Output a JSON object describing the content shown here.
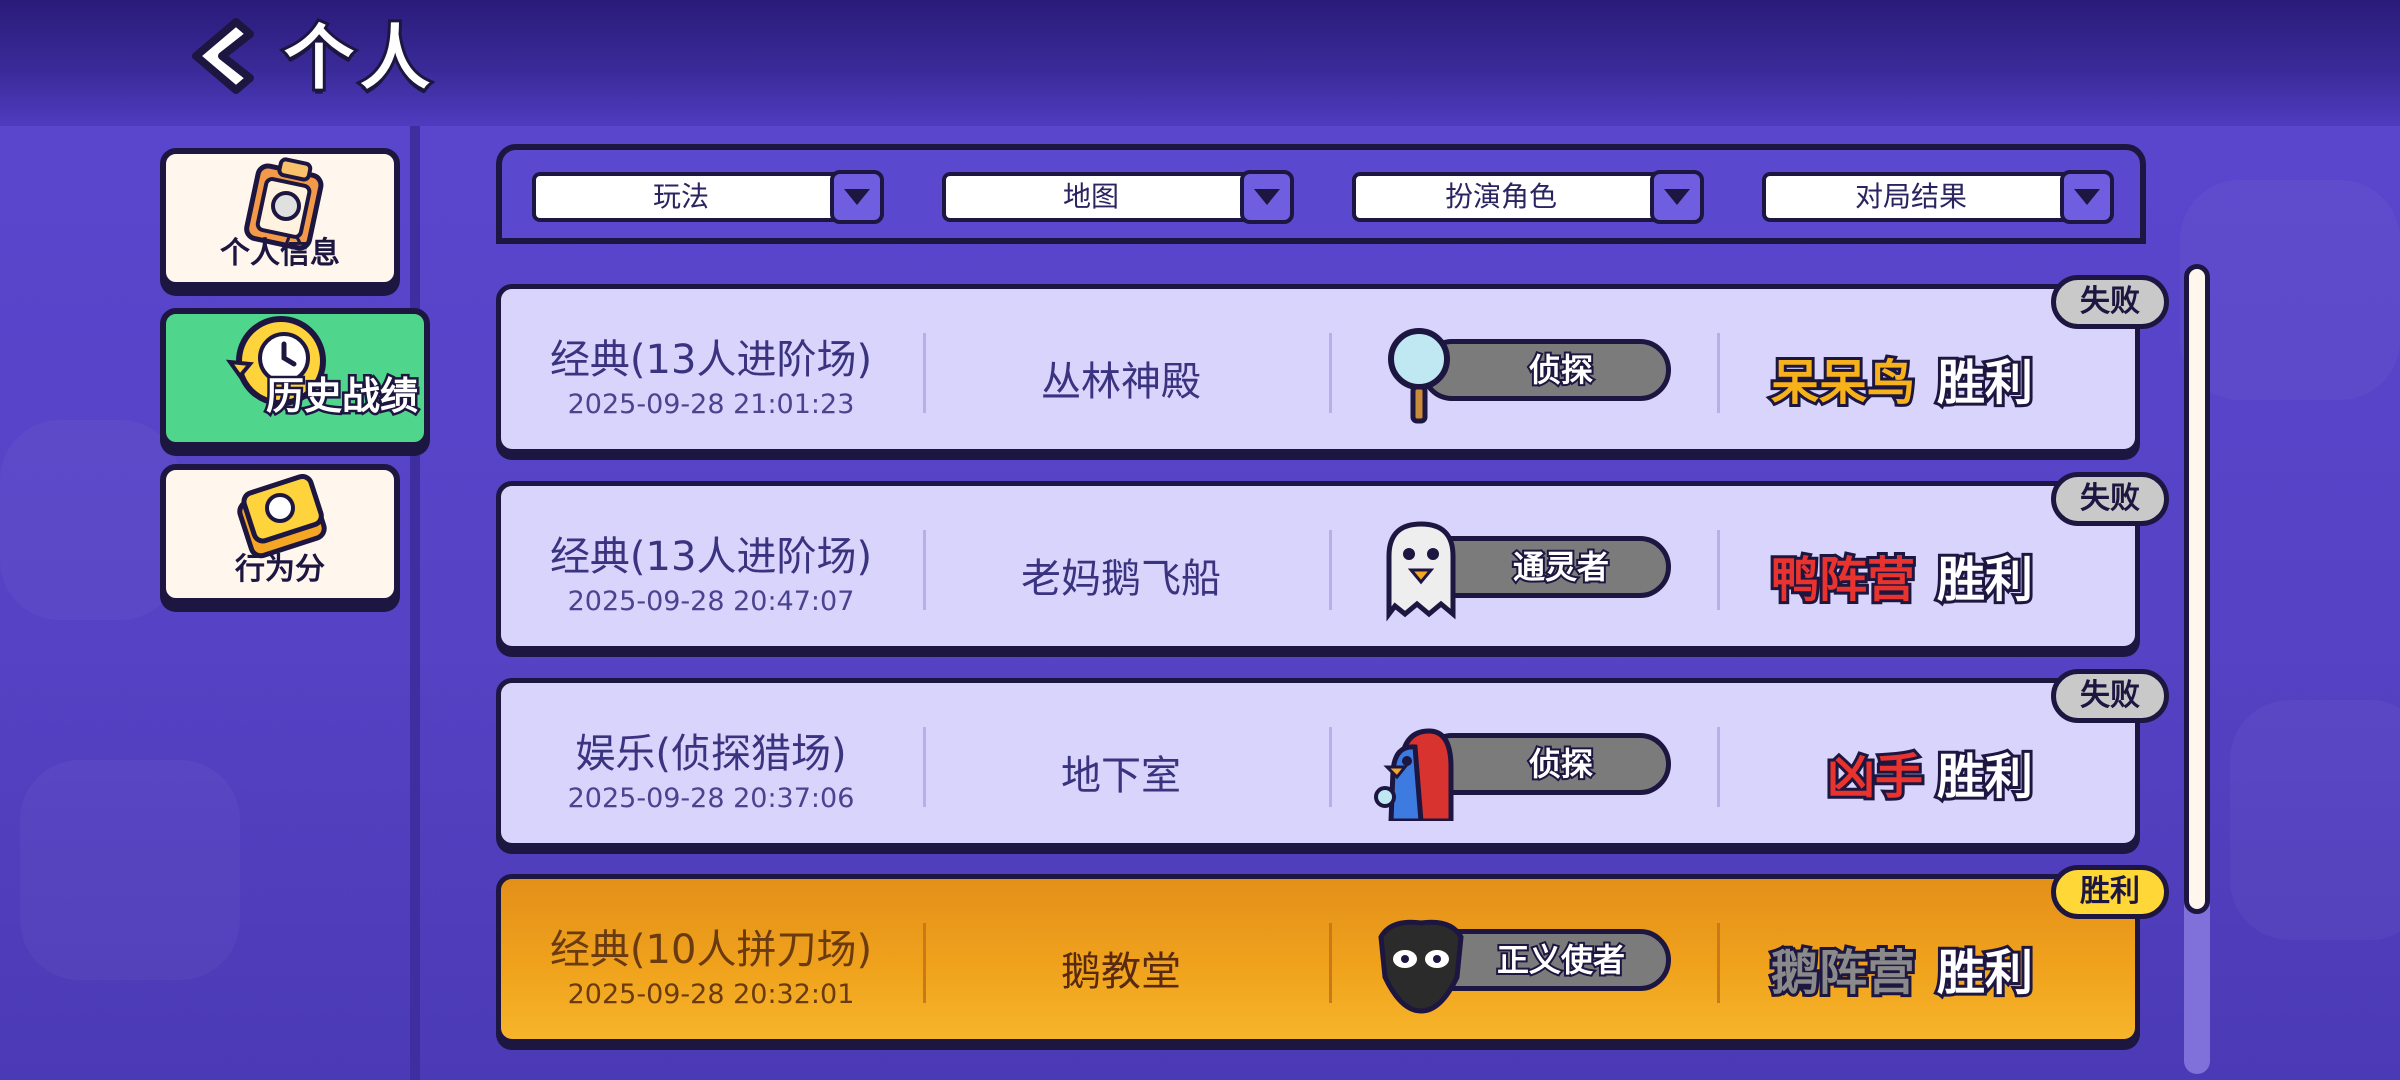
{
  "header": {
    "title": "个人"
  },
  "sidebar": {
    "items": [
      {
        "label": "个人信息",
        "active": false,
        "icon": "clipboard-icon"
      },
      {
        "label": "历史战绩",
        "active": true,
        "icon": "clock-history-icon"
      },
      {
        "label": "行为分",
        "active": false,
        "icon": "badge-score-icon"
      }
    ]
  },
  "filters": [
    {
      "label": "玩法"
    },
    {
      "label": "地图"
    },
    {
      "label": "扮演角色"
    },
    {
      "label": "对局结果"
    }
  ],
  "records": [
    {
      "mode": "经典(13人进阶场)",
      "time": "2025-09-28 21:01:23",
      "map": "丛林神殿",
      "role": "侦探",
      "role_icon": "magnifier-icon",
      "camp": "呆呆鸟",
      "camp_color": "#f7b21b",
      "camp_result": "胜利",
      "badge": "失败",
      "outcome": "lose"
    },
    {
      "mode": "经典(13人进阶场)",
      "time": "2025-09-28 20:47:07",
      "map": "老妈鹅飞船",
      "role": "通灵者",
      "role_icon": "ghost-goose-icon",
      "camp": "鸭阵营",
      "camp_color": "#e8332e",
      "camp_result": "胜利",
      "badge": "失败",
      "outcome": "lose"
    },
    {
      "mode": "娱乐(侦探猎场)",
      "time": "2025-09-28 20:37:06",
      "map": "地下室",
      "role": "侦探",
      "role_icon": "duck-detective-icon",
      "camp": "凶手",
      "camp_color": "#e8332e",
      "camp_result": "胜利",
      "badge": "失败",
      "outcome": "lose"
    },
    {
      "mode": "经典(10人拼刀场)",
      "time": "2025-09-28 20:32:01",
      "map": "鹅教堂",
      "role": "正义使者",
      "role_icon": "masked-avenger-icon",
      "camp": "鹅阵营",
      "camp_color": "#8a8a8a",
      "camp_result": "胜利",
      "badge": "胜利",
      "outcome": "win"
    }
  ],
  "colors": {
    "accent": "#5a48cf",
    "win_badge": "#ffd736",
    "lose_badge": "#c9c9c9",
    "active_tab": "#4fd68c"
  }
}
